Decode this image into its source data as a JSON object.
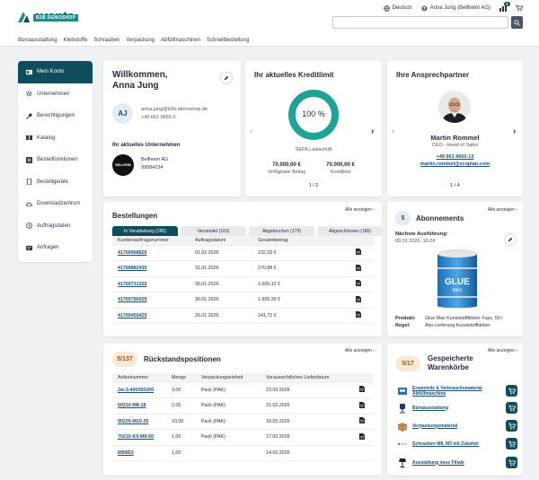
{
  "brand": {
    "name": "avanta",
    "badge": "B2B DEMOSHOP"
  },
  "topbar": {
    "language": "Deutsch",
    "user": "Anna Jung (Bellheim AG)",
    "cart_count": "2"
  },
  "search": {
    "placeholder": ""
  },
  "nav": [
    "Büroausstattung",
    "Klebstoffe",
    "Schrauben",
    "Verpackung",
    "Abfüllmaschinen",
    "Schnellbestellung"
  ],
  "sidebar": [
    {
      "label": "Mein Konto",
      "icon": "account-icon"
    },
    {
      "label": "Unternehmen",
      "icon": "settings-icon"
    },
    {
      "label": "Berechtigungen",
      "icon": "key-icon"
    },
    {
      "label": "Katalog",
      "icon": "book-icon"
    },
    {
      "label": "Bestellfunktionen",
      "icon": "list-icon"
    },
    {
      "label": "Bestellgeräte",
      "icon": "device-icon"
    },
    {
      "label": "Downloadzentrum",
      "icon": "download-icon"
    },
    {
      "label": "Auftragsdaten",
      "icon": "history-icon"
    },
    {
      "label": "Anfragen",
      "icon": "inbox-icon"
    }
  ],
  "welcome": {
    "title_line1": "Willkommen,",
    "title_line2": "Anna Jung",
    "initials": "AJ",
    "email": "anna.jung@b2b-demoshop.de",
    "phone": "+49 661 9650 0",
    "company_heading": "Ihr aktuelles Unternehmen",
    "company_name": "Bellheim AG",
    "company_id": "99084234",
    "company_logo": "BELLHEIM"
  },
  "credit": {
    "title": "Ihr aktuelles Kreditlimit",
    "percent": "100 %",
    "percent_value": 100,
    "method": "SEPA Lastschrift",
    "available": "70.000,00 €",
    "available_label": "Verfügbarer Betrag",
    "limit": "70.000,00 €",
    "limit_label": "Kreditlimit",
    "pager": "1 / 2",
    "accent": "#1fa396"
  },
  "contact": {
    "title": "Ihre Ansprechpartner",
    "name": "Martin Rommel",
    "role": "CEO - Head of Sales",
    "phone": "+49 661 9650-13",
    "email": "martin.rommel@ecoplan.com",
    "pager": "1 / 4"
  },
  "orders": {
    "title": "Bestellungen",
    "all_link": "Alle anzeigen ›",
    "tabs": [
      "In Verarbeitung (265)",
      "Versendet (183)",
      "Abgebrochen (179)",
      "Abgeschlossen (186)"
    ],
    "columns": [
      "Kundenauftragsnummer",
      "Auftragsdatum",
      "Gesamtbetrag"
    ],
    "rows": [
      [
        "41769968826",
        "01.02.2026",
        "232,33 €"
      ],
      [
        "41769882430",
        "31.01.2026",
        "270,88 €"
      ],
      [
        "41769731329",
        "30.01.2026",
        "1.009,12 €"
      ],
      [
        "41769796029",
        "30.01.2026",
        "1.605,39 €"
      ],
      [
        "41769450429",
        "26.01.2026",
        "141,72 €"
      ]
    ]
  },
  "subscriptions": {
    "count": "5",
    "title": "Abonnements",
    "all_link": "Alle anzeigen ›",
    "next_label": "Nächste Ausführung:",
    "next_value": "09.02.2026, 16:24",
    "product_label": "Produkt:",
    "product_value": "Glue Max Kunststoffkleber Fass, 50 l",
    "rule_label": "Regel:",
    "rule_value": "Abo-Lieferung Kunststoffkleber",
    "bucket_text1": "GLUE",
    "bucket_text2": "MAX"
  },
  "backorders": {
    "count": "5/137",
    "title": "Rückstandspositionen",
    "all_link": "Alle anzeigen ›",
    "columns": [
      "Artikelnummer",
      "Menge",
      "Verpackungseinheit",
      "Voraussichtliches Lieferdatum"
    ],
    "rows": [
      [
        "2w-3-400350200",
        "3,00",
        "Pack (PAK)",
        "23.03.2026"
      ],
      [
        "60210-M8-18",
        "2,00",
        "Pack (PAK)",
        "21.03.2026"
      ],
      [
        "90220-M10-25",
        "10,00",
        "Pack (PAK)",
        "18.03.2026"
      ],
      [
        "70210-K5-M6-50",
        "1,00",
        "Pack (PAK)",
        "17.03.2026"
      ],
      [
        "895853",
        "1,00",
        "",
        "14.03.2026"
      ]
    ]
  },
  "wishlists": {
    "count": "5/17",
    "title_line1": "Gespeicherte",
    "title_line2": "Warenkörbe",
    "all_link": "Alle anzeigen ›",
    "items": [
      {
        "label": "Ersatzteile & Verbrauchsmaterial Abfüllmaschine",
        "icon": "machine-icon"
      },
      {
        "label": "Büroausstattung",
        "icon": "chair-icon"
      },
      {
        "label": "Verpackungsmaterial",
        "icon": "box-icon"
      },
      {
        "label": "Schrauben M8, M3 mit Zubehör",
        "icon": "screw-icon"
      },
      {
        "label": "Ausstattung neue Filiale",
        "icon": "lamp-icon"
      }
    ]
  }
}
